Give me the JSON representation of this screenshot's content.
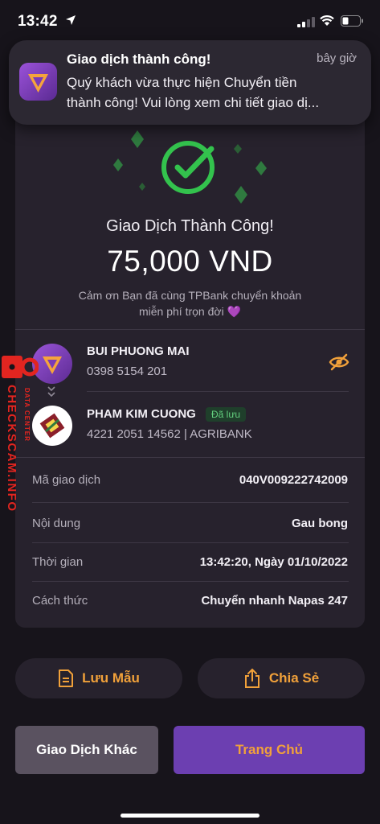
{
  "status_bar": {
    "time": "13:42"
  },
  "notification": {
    "title": "Giao dịch thành công!",
    "when": "bây giờ",
    "body_line1": "Quý khách vừa thực hiện Chuyển tiền",
    "body_line2": "thành công! Vui lòng xem chi tiết giao dị..."
  },
  "receipt": {
    "success_title": "Giao Dịch Thành Công!",
    "amount": "75,000 VND",
    "thanks_line1": "Cảm ơn Bạn đã cùng TPBank chuyển khoản",
    "thanks_line2": "miễn phí trọn đời 💜",
    "sender": {
      "name": "BUI PHUONG MAI",
      "account": "0398 5154 201"
    },
    "receiver": {
      "name": "PHAM KIM CUONG",
      "saved_badge": "Đã lưu",
      "account": "4221 2051 14562 | AGRIBANK"
    },
    "details": [
      {
        "label": "Mã giao dịch",
        "value": "040V009222742009"
      },
      {
        "label": "Nội dung",
        "value": "Gau bong"
      },
      {
        "label": "Thời gian",
        "value": "13:42:20, Ngày 01/10/2022"
      },
      {
        "label": "Cách thức",
        "value": "Chuyển nhanh Napas 247"
      }
    ]
  },
  "actions": {
    "save_template": "Lưu Mẫu",
    "share": "Chia Sẻ",
    "other_transaction": "Giao Dịch Khác",
    "home": "Trang Chủ"
  },
  "watermark": {
    "text": "CHECKSCAM.INFO",
    "sub": "DATA CENTER"
  },
  "colors": {
    "accent": "#f1a13a",
    "primary": "#6c3fb1",
    "success": "#33c24d"
  }
}
